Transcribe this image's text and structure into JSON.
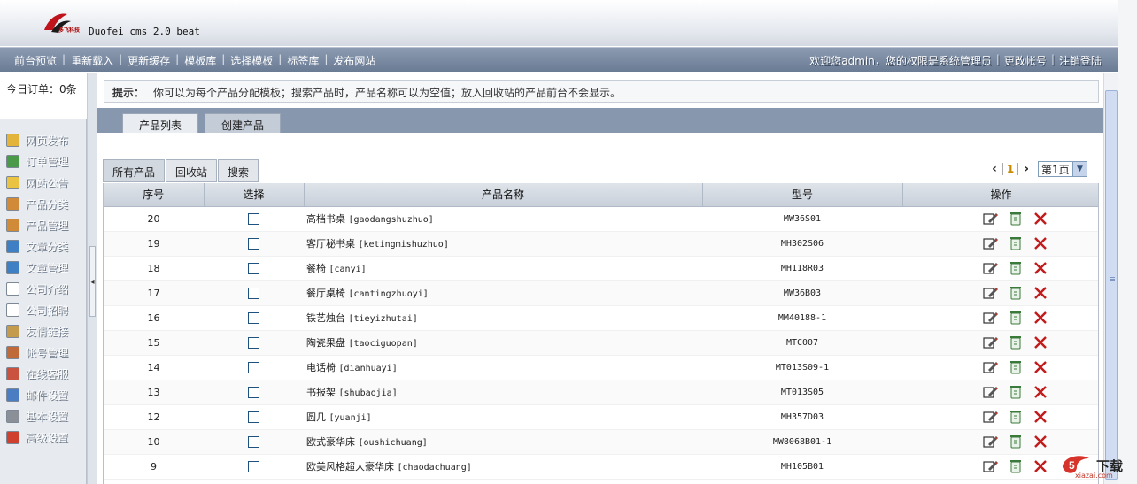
{
  "header": {
    "title": "Duofei cms 2.0 beat",
    "logo_text": "多飞科技"
  },
  "nav": {
    "left": [
      "前台预览",
      "重新载入",
      "更新缓存",
      "模板库",
      "选择模板",
      "标签库",
      "发布网站"
    ],
    "welcome": "欢迎您admin，您的权限是系统管理员",
    "change_account": "更改帐号",
    "logout": "注销登陆"
  },
  "sidebar": {
    "orders": "今日订单：0条",
    "items": [
      {
        "label": "网页发布",
        "icon": "megaphone-icon",
        "color": "#e2b43a"
      },
      {
        "label": "订单管理",
        "icon": "cart-icon",
        "color": "#4a9a4a"
      },
      {
        "label": "网站公告",
        "icon": "lightbulb-icon",
        "color": "#e9c341"
      },
      {
        "label": "产品分类",
        "icon": "magnifier-icon",
        "color": "#d08a38"
      },
      {
        "label": "产品管理",
        "icon": "magnifier-icon",
        "color": "#d08a38"
      },
      {
        "label": "文章分类",
        "icon": "chart-icon",
        "color": "#3f7fc4"
      },
      {
        "label": "文章管理",
        "icon": "chart-icon",
        "color": "#3f7fc4"
      },
      {
        "label": "公司介绍",
        "icon": "document-icon",
        "color": "#ffffff"
      },
      {
        "label": "公司招聘",
        "icon": "document-icon",
        "color": "#ffffff"
      },
      {
        "label": "友情链接",
        "icon": "link-icon",
        "color": "#c49b4d"
      },
      {
        "label": "帐号管理",
        "icon": "users-icon",
        "color": "#c06a3a"
      },
      {
        "label": "在线客服",
        "icon": "support-icon",
        "color": "#c9533f"
      },
      {
        "label": "邮件设置",
        "icon": "mail-icon",
        "color": "#4a7dc1"
      },
      {
        "label": "基本设置",
        "icon": "gear-icon",
        "color": "#8a8f98"
      },
      {
        "label": "高级设置",
        "icon": "warning-icon",
        "color": "#d0402f"
      }
    ]
  },
  "tip": {
    "label": "提示：",
    "text": "你可以为每个产品分配模板；搜索产品时，产品名称可以为空值；放入回收站的产品前台不会显示。"
  },
  "tabs": [
    "产品列表",
    "创建产品"
  ],
  "subtabs": [
    "所有产品",
    "回收站",
    "搜索"
  ],
  "pager": {
    "current": "1",
    "select": "第1页"
  },
  "table": {
    "headers": [
      "序号",
      "选择",
      "产品名称",
      "型号",
      "操作"
    ],
    "rows": [
      {
        "num": "20",
        "name": "高档书桌",
        "pinyin": "[gaodangshuzhuo]",
        "model": "MW36S01"
      },
      {
        "num": "19",
        "name": "客厅秘书桌",
        "pinyin": "[ketingmishuzhuo]",
        "model": "MH302S06"
      },
      {
        "num": "18",
        "name": "餐椅",
        "pinyin": "[canyi]",
        "model": "MH118R03"
      },
      {
        "num": "17",
        "name": "餐厅桌椅",
        "pinyin": "[cantingzhuoyi]",
        "model": "MW36B03"
      },
      {
        "num": "16",
        "name": "铁艺烛台",
        "pinyin": "[tieyizhutai]",
        "model": "MM40188-1"
      },
      {
        "num": "15",
        "name": "陶瓷果盘",
        "pinyin": "[taociguopan]",
        "model": "MTC007"
      },
      {
        "num": "14",
        "name": "电话椅",
        "pinyin": "[dianhuayi]",
        "model": "MT013S09-1"
      },
      {
        "num": "13",
        "name": "书报架",
        "pinyin": "[shubaojia]",
        "model": "MT013S05"
      },
      {
        "num": "12",
        "name": "圆几",
        "pinyin": "[yuanji]",
        "model": "MH357D03"
      },
      {
        "num": "10",
        "name": "欧式豪华床",
        "pinyin": "[oushichuang]",
        "model": "MW8068B01-1"
      },
      {
        "num": "9",
        "name": "欧美风格超大豪华床",
        "pinyin": "[chaodachuang]",
        "model": "MH105B01"
      }
    ]
  },
  "watermark": {
    "text": "下载",
    "sub": "xiazai.com"
  }
}
